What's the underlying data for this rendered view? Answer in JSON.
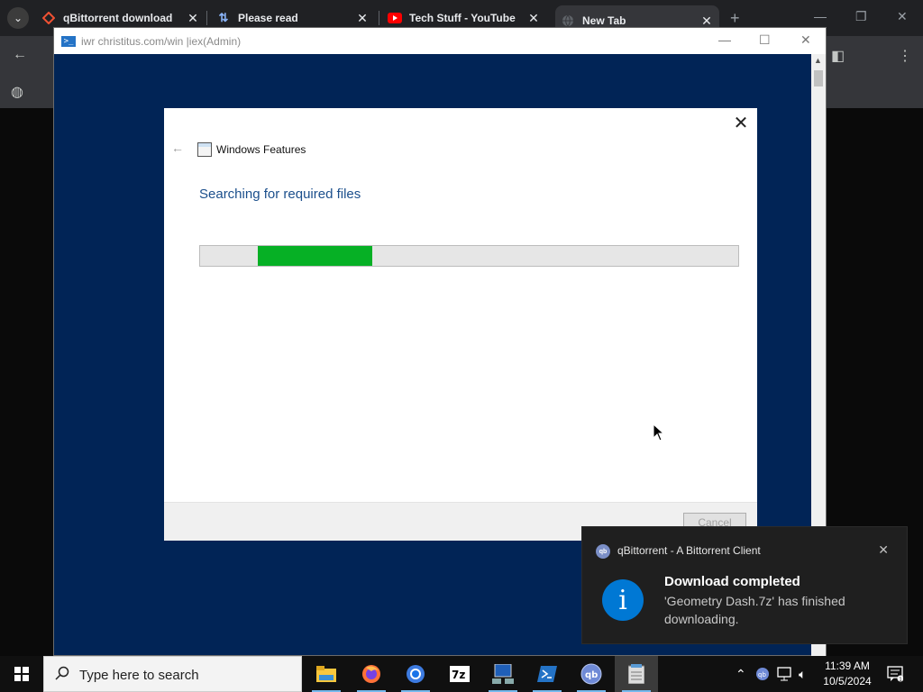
{
  "browser": {
    "tabs": [
      {
        "label": "qBittorrent download"
      },
      {
        "label": "Please read"
      },
      {
        "label": "Tech Stuff - YouTube"
      },
      {
        "label": "New Tab"
      }
    ]
  },
  "powershell": {
    "title": "iwr christitus.com/win |iex(Admin)"
  },
  "dialog": {
    "app_title": "Windows Features",
    "heading": "Searching for required files",
    "progress": {
      "start": 0.108,
      "end": 0.32
    },
    "cancel_label": "Cancel"
  },
  "toast": {
    "app_name": "qBittorrent - A Bittorrent Client",
    "app_icon_text": "qb",
    "title": "Download completed",
    "body": "'Geometry Dash.7z' has finished downloading."
  },
  "taskbar": {
    "search_placeholder": "Type here to search",
    "pinned": [
      "file-explorer",
      "firefox",
      "chrome",
      "7-zip",
      "network-admin",
      "powershell",
      "qbittorrent",
      "notepad"
    ],
    "time": "11:39 AM",
    "date": "10/5/2024"
  },
  "colors": {
    "progress_fill": "#06b025",
    "powershell_bg": "#012456",
    "info_accent": "#0078d4"
  }
}
